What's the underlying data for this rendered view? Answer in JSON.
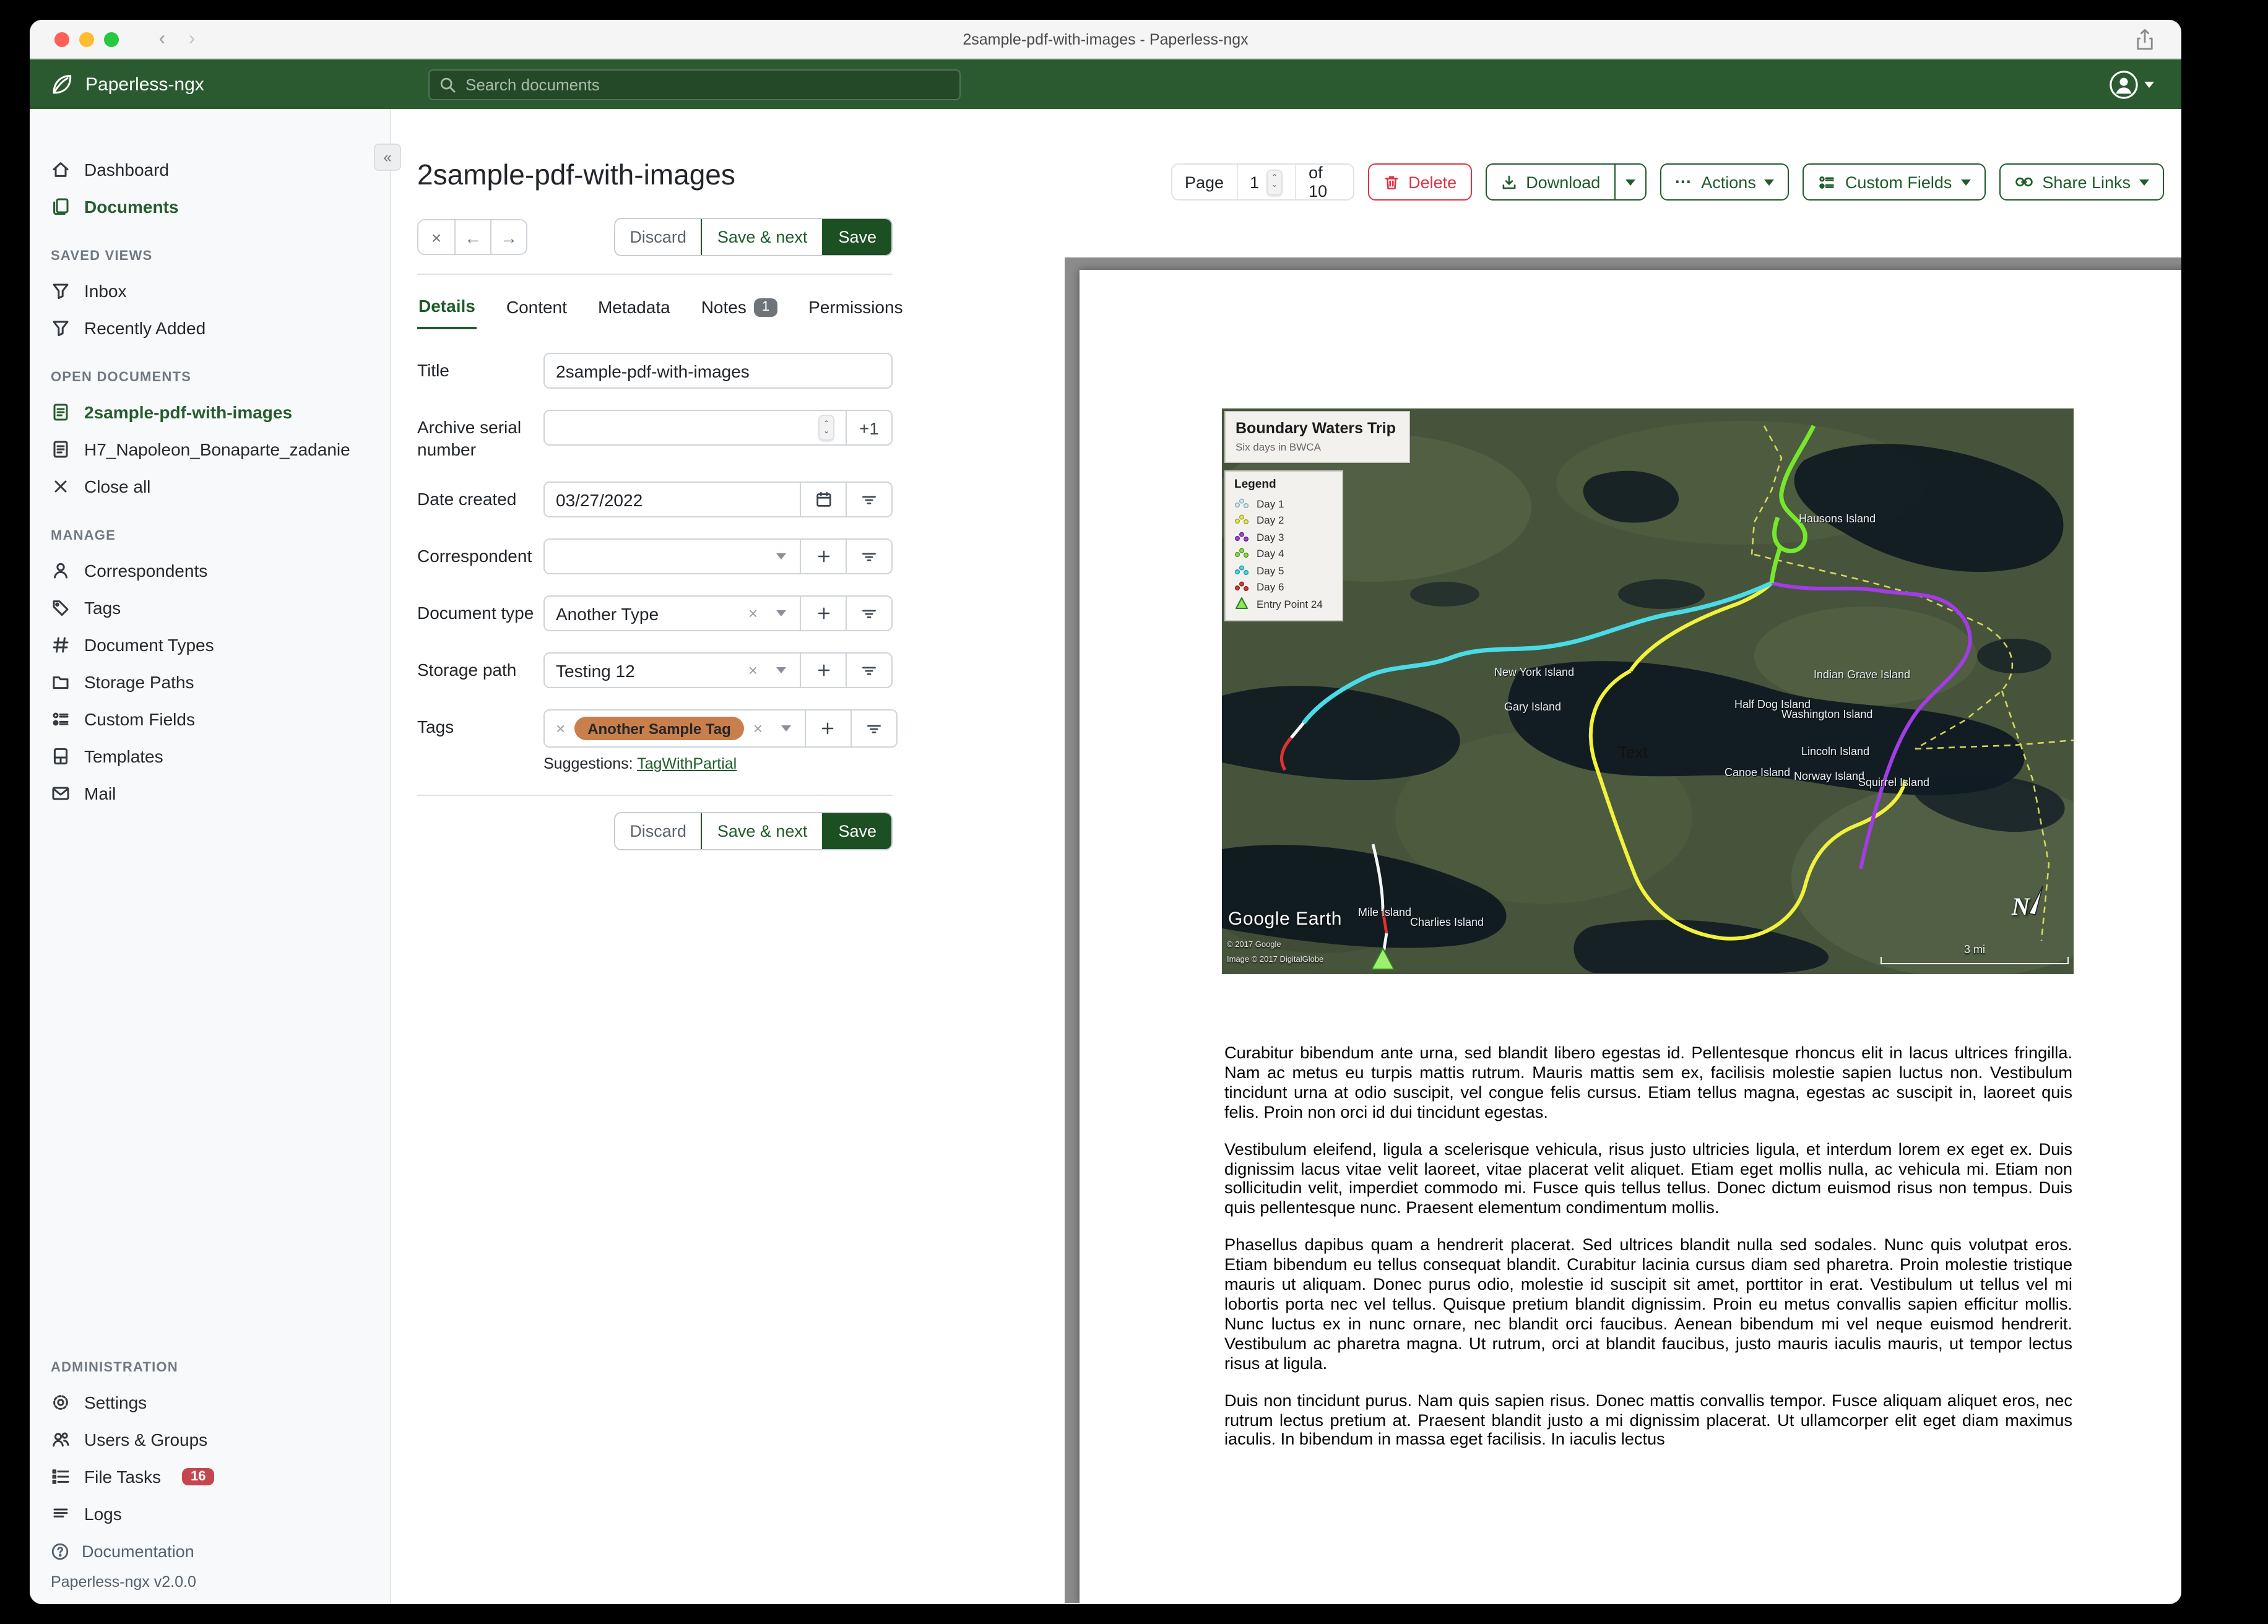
{
  "window": {
    "title": "2sample-pdf-with-images - Paperless-ngx"
  },
  "header": {
    "app_name": "Paperless-ngx",
    "search_placeholder": "Search documents"
  },
  "sidebar": {
    "items": [
      {
        "label": "Dashboard"
      },
      {
        "label": "Documents"
      }
    ],
    "sections": [
      {
        "title": "SAVED VIEWS",
        "items": [
          {
            "label": "Inbox"
          },
          {
            "label": "Recently Added"
          }
        ]
      },
      {
        "title": "OPEN DOCUMENTS",
        "items": [
          {
            "label": "2sample-pdf-with-images"
          },
          {
            "label": "H7_Napoleon_Bonaparte_zadanie"
          },
          {
            "label": "Close all"
          }
        ]
      },
      {
        "title": "MANAGE",
        "items": [
          {
            "label": "Correspondents"
          },
          {
            "label": "Tags"
          },
          {
            "label": "Document Types"
          },
          {
            "label": "Storage Paths"
          },
          {
            "label": "Custom Fields"
          },
          {
            "label": "Templates"
          },
          {
            "label": "Mail"
          }
        ]
      },
      {
        "title": "ADMINISTRATION",
        "items": [
          {
            "label": "Settings"
          },
          {
            "label": "Users & Groups"
          },
          {
            "label": "File Tasks",
            "badge": "16"
          },
          {
            "label": "Logs"
          }
        ]
      }
    ],
    "footer": {
      "documentation": "Documentation",
      "version": "Paperless-ngx v2.0.0"
    }
  },
  "toolbar": {
    "page_label": "Page",
    "page_value": "1",
    "of_label": "of 10",
    "delete_label": "Delete",
    "download_label": "Download",
    "actions_label": "Actions",
    "custom_fields_label": "Custom Fields",
    "share_links_label": "Share Links"
  },
  "document": {
    "title": "2sample-pdf-with-images",
    "actions": {
      "discard": "Discard",
      "save_next": "Save & next",
      "save": "Save"
    },
    "tabs": [
      {
        "label": "Details"
      },
      {
        "label": "Content"
      },
      {
        "label": "Metadata"
      },
      {
        "label": "Notes",
        "badge": "1"
      },
      {
        "label": "Permissions"
      }
    ],
    "fields": {
      "title_label": "Title",
      "title_value": "2sample-pdf-with-images",
      "asn_label": "Archive serial number",
      "asn_plus": "+1",
      "date_label": "Date created",
      "date_value": "03/27/2022",
      "correspondent_label": "Correspondent",
      "doctype_label": "Document type",
      "doctype_value": "Another Type",
      "storage_label": "Storage path",
      "storage_value": "Testing 12",
      "tags_label": "Tags",
      "tag_value": "Another Sample Tag",
      "suggestions_label": "Suggestions:",
      "suggestion_link": "TagWithPartial"
    }
  },
  "colors": {
    "header_green": "#2b5a31",
    "accent_green": "#1e5b29",
    "save_fill": "#1c4f22",
    "tag_pill": "#c97f4c",
    "file_tasks_badge": "#c5464f",
    "delete_red": "#dc3545"
  },
  "preview": {
    "map": {
      "title": "Boundary Waters Trip",
      "subtitle": "Six days in BWCA",
      "legend_title": "Legend",
      "legend": [
        {
          "label": "Day 1",
          "color": "#cfe8ee"
        },
        {
          "label": "Day 2",
          "color": "#e6e64a"
        },
        {
          "label": "Day 3",
          "color": "#9b3fe0"
        },
        {
          "label": "Day 4",
          "color": "#86e03c"
        },
        {
          "label": "Day 5",
          "color": "#46d7e6"
        },
        {
          "label": "Day 6",
          "color": "#cc3a3a"
        },
        {
          "label": "Entry Point 24",
          "color": "#8ae85c"
        }
      ],
      "labels": {
        "hausons": "Hausons Island",
        "newyork": "New York Island",
        "gary": "Gary Island",
        "indiangrave": "Indian Grave Island",
        "halfdog": "Half Dog Island",
        "washington": "Washington Island",
        "lincoln": "Lincoln Island",
        "canoe": "Canoe Island",
        "norway": "Norway Island",
        "squirrel": "Squirrel Island",
        "mile": "Mile Island",
        "charlies": "Charlies Island",
        "text_note": "Text"
      },
      "attribution": {
        "logo": "Google Earth",
        "line1": "© 2017 Google",
        "line2": "Image © 2017 DigitalGlobe"
      },
      "compass": "N",
      "scale_label": "3 mi"
    },
    "paragraphs": [
      "Curabitur bibendum ante urna, sed blandit libero egestas id. Pellentesque rhoncus elit in lacus ultrices fringilla. Nam ac metus eu turpis mattis rutrum. Mauris mattis sem ex, facilisis molestie sapien luctus non. Vestibulum tincidunt urna at odio suscipit, vel congue felis cursus. Etiam tellus magna, egestas ac suscipit in, laoreet quis felis. Proin non orci id dui tincidunt egestas.",
      "Vestibulum eleifend, ligula a scelerisque vehicula, risus justo ultricies ligula, et interdum lorem ex eget ex. Duis dignissim lacus vitae velit laoreet, vitae placerat velit aliquet. Etiam eget mollis nulla, ac vehicula mi. Etiam non sollicitudin velit, imperdiet commodo mi. Fusce quis tellus tellus. Donec dictum euismod risus non tempus. Duis quis pellentesque nunc. Praesent elementum condimentum mollis.",
      "Phasellus dapibus quam a hendrerit placerat. Sed ultrices blandit nulla sed sodales. Nunc quis volutpat eros. Etiam bibendum eu tellus consequat blandit. Curabitur lacinia cursus diam sed pharetra. Proin molestie tristique mauris ut aliquam. Donec purus odio, molestie id suscipit sit amet, porttitor in erat. Vestibulum ut tellus vel mi lobortis porta nec vel tellus. Quisque pretium blandit dignissim. Proin eu metus convallis sapien efficitur mollis. Nunc luctus ex in nunc ornare, nec blandit orci faucibus. Aenean bibendum mi vel neque euismod hendrerit. Vestibulum ac pharetra magna. Ut rutrum, orci at blandit faucibus, justo mauris iaculis mauris, ut tempor lectus risus at ligula.",
      "Duis non tincidunt purus. Nam quis sapien risus. Donec mattis convallis tempor. Fusce aliquam aliquet eros, nec rutrum lectus pretium at. Praesent blandit justo a mi dignissim placerat. Ut ullamcorper elit eget diam maximus iaculis. In bibendum in massa eget facilisis. In iaculis lectus"
    ]
  }
}
